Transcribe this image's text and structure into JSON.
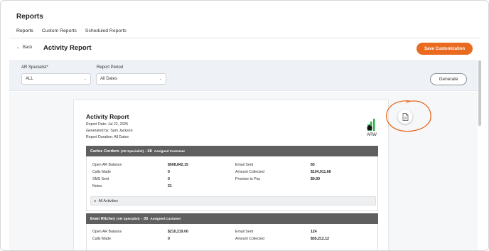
{
  "app": {
    "title": "Reports"
  },
  "tabs": [
    {
      "label": "Reports",
      "active": true
    },
    {
      "label": "Custom Reports",
      "active": false
    },
    {
      "label": "Scheduled Reports",
      "active": false
    }
  ],
  "header": {
    "back_label": "Back",
    "page_title": "Activity Report",
    "save_label": "Save Customization"
  },
  "filters": {
    "ar_specialist": {
      "label": "AR Specialist*",
      "value": "ALL"
    },
    "report_period": {
      "label": "Report Period",
      "value": "All Dates"
    },
    "generate_label": "Generate"
  },
  "report": {
    "title": "Activity Report",
    "report_date": "Report Date: Jul 22, 2025",
    "generated_by": "Generated by: Sam Jackson",
    "duration": "Report Duration: All Dates",
    "logo_text": "ARW",
    "sections": [
      {
        "name": "Carlos Cordero",
        "role": "(AR Specialist)",
        "count_label": "- 68",
        "suffix": "Assigned Customer",
        "left": [
          {
            "label": "Open AR Balance",
            "value": "$608,842.15"
          },
          {
            "label": "Calls Made",
            "value": "0"
          },
          {
            "label": "SMS Sent",
            "value": "0"
          },
          {
            "label": "Notes",
            "value": "21"
          }
        ],
        "right": [
          {
            "label": "Email Sent",
            "value": "83"
          },
          {
            "label": "Amount Collected",
            "value": "$104,911.68"
          },
          {
            "label": "Promise to Pay",
            "value": "$0.00"
          }
        ],
        "all_activities_label": "All Activities"
      },
      {
        "name": "Evan Ritchey",
        "role": "(AR Specialist)",
        "count_label": "- 35",
        "suffix": "Assigned Customer",
        "left": [
          {
            "label": "Open AR Balance",
            "value": "$210,219.00"
          },
          {
            "label": "Calls Made",
            "value": "0"
          }
        ],
        "right": [
          {
            "label": "Email Sent",
            "value": "124"
          },
          {
            "label": "Amount Collected",
            "value": "$55,212.12"
          }
        ]
      }
    ]
  },
  "colors": {
    "accent": "#ea6a1f",
    "section_bar": "#5f5f5f",
    "filter_bg": "#eef1f5",
    "annotation": "#e8691e",
    "logo_green": "#2db34a"
  },
  "icons": {
    "export": "document-icon",
    "back": "arrow-left-icon",
    "expand": "caret-right-icon"
  }
}
